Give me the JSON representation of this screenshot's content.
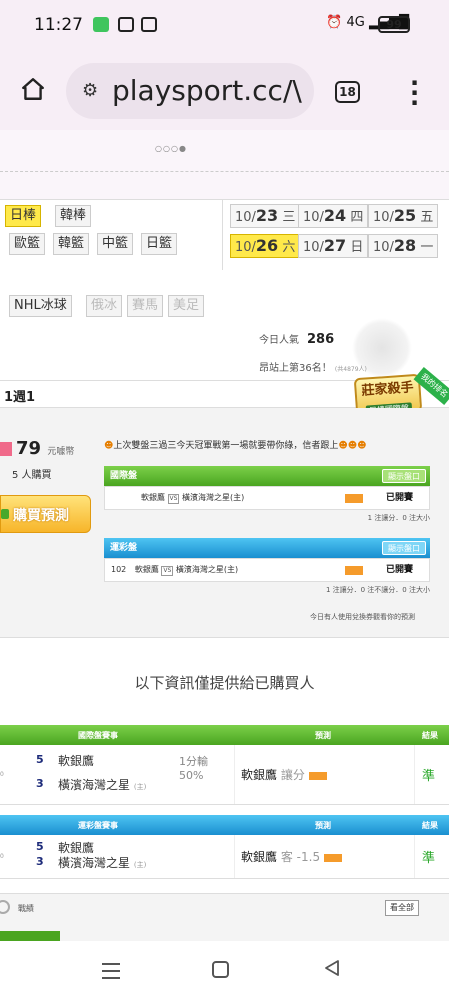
{
  "status": {
    "time": "11:27",
    "network": "4G",
    "battery": "99"
  },
  "browser": {
    "url": "playsport.cc/\\",
    "tab_count": "18"
  },
  "sports": {
    "row1": [
      "日棒",
      "韓棒"
    ],
    "row2": [
      "歐籃",
      "韓籃",
      "中籃",
      "日籃"
    ],
    "row3": [
      "NHL冰球",
      "俄冰",
      "賽馬",
      "美足"
    ]
  },
  "dates": [
    {
      "day": "10/",
      "num": "23",
      "weekday": "三"
    },
    {
      "day": "10/",
      "num": "24",
      "weekday": "四"
    },
    {
      "day": "10/",
      "num": "25",
      "weekday": "五"
    },
    {
      "day": "10/",
      "num": "26",
      "weekday": "六"
    },
    {
      "day": "10/",
      "num": "27",
      "weekday": "日"
    },
    {
      "day": "10/",
      "num": "28",
      "weekday": "一"
    }
  ],
  "popularity": {
    "label": "今日人氣",
    "value": "286"
  },
  "rank": {
    "text": "昂站上第36名！",
    "note": "(共4879人)"
  },
  "week": {
    "label": "1週1"
  },
  "badge": {
    "title": "莊家殺手",
    "sub": "日棒國際盤",
    "ribbon": "我的排名"
  },
  "seller": {
    "price": "79",
    "unit": "元噱幣",
    "buyers": "5 人購買",
    "buy_label": "購買預測",
    "notice": "上次雙盤三過三今天冠軍戰第一場就要帶你綠，信者跟上"
  },
  "intl": {
    "header": "國際盤",
    "show": "顯示盤口",
    "home": "軟銀鷹",
    "away": "橫濱海灣之星(主)",
    "status": "已開賽",
    "foot": "1 注讓分．0 注大小"
  },
  "lottery": {
    "header": "運彩盤",
    "show": "顯示盤口",
    "num": "102",
    "home": "軟銀鷹",
    "away": "橫濱海灣之星(主)",
    "status": "已開賽",
    "foot": "1 注讓分．0 注不讓分．0 注大小"
  },
  "today_note": "今日有人使用兌換券觀看你的預測",
  "info_text": "以下資訊僅提供給已購買人",
  "intl_table": {
    "head_match": "國際盤賽事",
    "head_pred": "預測",
    "head_res": "結果",
    "home_num": "5",
    "home": "軟銀鷹",
    "away_num": "3",
    "away": "橫濱海灣之星",
    "away_tag": "(主)",
    "handicap1": "1分輸",
    "handicap2": "50%",
    "pred_team": "軟銀鷹",
    "pred_type": "讓分",
    "result": "準"
  },
  "lottery_table": {
    "head_match": "運彩盤賽事",
    "head_pred": "預測",
    "head_res": "結果",
    "home_num": "5",
    "home": "軟銀鷹",
    "away_num": "3",
    "away": "橫濱海灣之星",
    "away_tag": "(主)",
    "pred_team": "軟銀鷹",
    "pred_type": "客 -1.5",
    "result": "準"
  },
  "record": {
    "label": "戰績",
    "all": "看全部"
  },
  "colors": {
    "green": "#4aa520",
    "blue": "#1a8fd0",
    "yellow": "#ffe94a",
    "accent_pink": "#f06a8a"
  }
}
